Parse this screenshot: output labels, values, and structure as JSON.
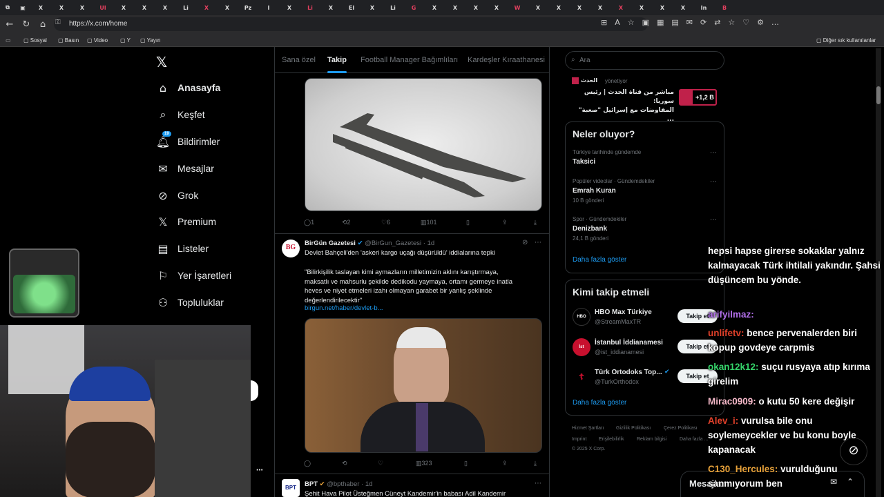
{
  "browser": {
    "url": "https://x.com/home",
    "tabs": [
      "X",
      "X",
      "X",
      "Ul",
      "X",
      "X",
      "X",
      "Li",
      "X",
      "X",
      "Pz",
      "I",
      "X",
      "Li",
      "X",
      "El",
      "X",
      "Li",
      "G",
      "X",
      "X",
      "X",
      "X",
      "W",
      "X",
      "X",
      "X",
      "X",
      "X",
      "X",
      "X",
      "X",
      "In",
      "B"
    ],
    "bookmarks": [
      "Sosyal",
      "Basın",
      "Video",
      "Y",
      "Yayın"
    ],
    "other_bookmarks": "Diğer sık kullanılanlar"
  },
  "nav": {
    "items": [
      {
        "label": "Anasayfa",
        "icon": "home-icon"
      },
      {
        "label": "Keşfet",
        "icon": "search-icon"
      },
      {
        "label": "Bildirimler",
        "icon": "bell-icon",
        "badge": "19"
      },
      {
        "label": "Mesajlar",
        "icon": "mail-icon"
      },
      {
        "label": "Grok",
        "icon": "grok-icon"
      },
      {
        "label": "Premium",
        "icon": "x-logo-icon"
      },
      {
        "label": "Listeler",
        "icon": "list-icon"
      },
      {
        "label": "Yer İşaretleri",
        "icon": "bookmark-icon"
      },
      {
        "label": "Topluluklar",
        "icon": "people-icon"
      }
    ]
  },
  "feed": {
    "tabs": [
      "Sana özel",
      "Takip",
      "Football Manager Bağımlıları",
      "Kardeşler Kıraathanesi"
    ],
    "active_tab": "Takip",
    "post1_actions": {
      "replies": "1",
      "reposts": "2",
      "likes": "6",
      "views": "101"
    },
    "post2": {
      "author": "BirGün Gazetesi",
      "handle": "@BirGun_Gazetesi",
      "time": "1d",
      "headline": "Devlet Bahçeli'den 'askeri kargo uçağı düşürüldü' iddialarına tepki",
      "quote_lines": [
        "\"Bilirkişilik taslayan kimi aymazların milletimizin aklını karıştırmaya,",
        "maksatlı ve mahsurlu şekilde dedikodu yaymaya, ortamı germeye inatla",
        "heves ve niyet etmeleri izahı olmayan garabet bir yanlış şeklinde",
        "değerlendirilecektir\""
      ],
      "link": "birgun.net/haber/devlet-b...",
      "views": "323"
    },
    "post3": {
      "author": "BPT",
      "handle": "@bpthaber",
      "time": "1d",
      "text": "Şehit Hava Pilot Üsteğmen Cüneyt Kandemir'in babası Adil Kandemir"
    }
  },
  "right": {
    "search_placeholder": "Ara",
    "live": {
      "host": "الحدث",
      "status": "yönetiyor",
      "line1": "مباشر من قناة الحدث | رئيس سوريا:",
      "line2": "المفاوضات مع إسرائيل \"صعبة\" ...",
      "count": "+1,2 B"
    },
    "trends_title": "Neler oluyor?",
    "trends": [
      {
        "context": "Türkiye tarihinde gündemde",
        "name": "Taksici",
        "count": ""
      },
      {
        "context": "Popüler videolar · Gündemdekiler",
        "name": "Emrah Kuran",
        "count": "10 B gönderi"
      },
      {
        "context": "Spor · Gündemdekiler",
        "name": "Denizbank",
        "count": "24,1 B gönderi"
      }
    ],
    "show_more": "Daha fazla göster",
    "follow_title": "Kimi takip etmeli",
    "follow": [
      {
        "name": "HBO Max Türkiye",
        "handle": "@StreamMaxTR",
        "button": "Takip et"
      },
      {
        "name": "İstanbul İddianamesi",
        "handle": "@ist_iddianamesi",
        "button": "Takip et"
      },
      {
        "name": "Türk Ortodoks Top...",
        "handle": "@TurkOrthodox",
        "button": "Takip et"
      }
    ],
    "footer": [
      "Hizmet Şartları",
      "Gizlilik Politikası",
      "Çerez Politikası",
      "Imprint",
      "Erişilebilirlik",
      "Reklam bilgisi",
      "Daha fazla ...",
      "© 2025 X Corp."
    ],
    "messages": "Mesajlar"
  },
  "chat": [
    {
      "user": "",
      "color": "#ffffff",
      "msg": "hepsi hapse girerse sokaklar yalnız kalmayacak Türk ihtilali yakındır. Şahsi düşüncem bu yönde."
    },
    {
      "user": "arifyilmaz:",
      "color": "#b06ee8",
      "msg": ""
    },
    {
      "user": "unlifetv:",
      "color": "#e0402a",
      "msg": "bence pervenalerden biri kopup govdeye carpmis"
    },
    {
      "user": "okan12k12:",
      "color": "#35d46a",
      "msg": "suçu rusyaya atıp kırıma girelim"
    },
    {
      "user": "Mirac0909:",
      "color": "#f4b8c8",
      "msg": "o kutu 50 kere değişir"
    },
    {
      "user": "Alev_i:",
      "color": "#e0402a",
      "msg": "vurulsa bile onu soylemeycekler ve bu konu boyle kapanacak"
    },
    {
      "user": "C130_Hercules:",
      "color": "#e8a23a",
      "msg": "vurulduğunu sanmıyorum ben"
    }
  ]
}
